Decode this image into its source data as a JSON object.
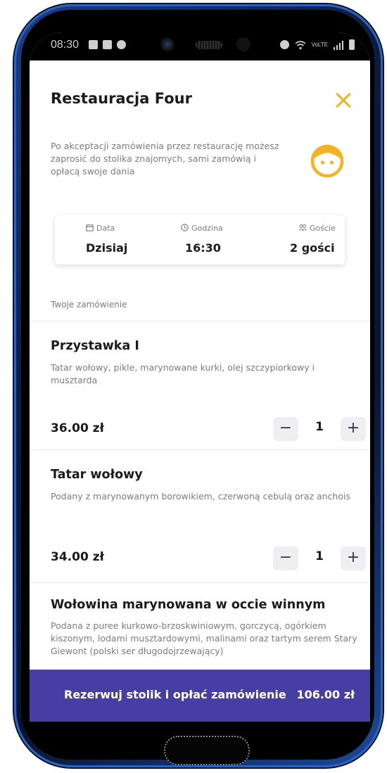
{
  "status": {
    "time": "08:30",
    "network_label": "VoLTE"
  },
  "header": {
    "title": "Restauracja Four"
  },
  "info": {
    "text": "Po akceptacji zamówienia przez restaurację możesz zaprosić do stolika znajomych, sami zamówią i opłacą swoje dania"
  },
  "booking": {
    "date_label": "Data",
    "date_value": "Dzisiaj",
    "time_label": "Godzina",
    "time_value": "16:30",
    "guests_label": "Goście",
    "guests_value": "2 gości"
  },
  "order_section": {
    "label": "Twoje zamówienie"
  },
  "items": [
    {
      "name": "Przystawka I",
      "description": "Tatar wołowy, pikle, marynowane kurki, olej szczypiorkowy i musztarda",
      "price": "36.00 zł",
      "quantity": "1"
    },
    {
      "name": "Tatar wołowy",
      "description": "Podany z marynowanym borowikiem, czerwoną cebulą oraz anchois",
      "price": "34.00 zł",
      "quantity": "1"
    },
    {
      "name": "Wołowina marynowana w occie winnym",
      "description": "Podana z puree kurkowo-brzoskwiniowym, gorczycą, ogórkiem kiszonym, lodami musztardowymi, malinami oraz tartym serem Stary Giewont (polski ser długodojrzewający)"
    }
  ],
  "stepper": {
    "minus": "−",
    "plus": "+"
  },
  "cta": {
    "label": "Rezerwuj stolik i opłać zamówienie",
    "total": "106.00 zł"
  },
  "colors": {
    "accent": "#f4b321",
    "primary": "#473ea4",
    "muted_text": "#7a7a85"
  },
  "icons": {
    "close": "close-icon",
    "face": "smiley-face-icon",
    "date": "calendar-icon",
    "time": "clock-icon",
    "guests": "people-icon"
  }
}
